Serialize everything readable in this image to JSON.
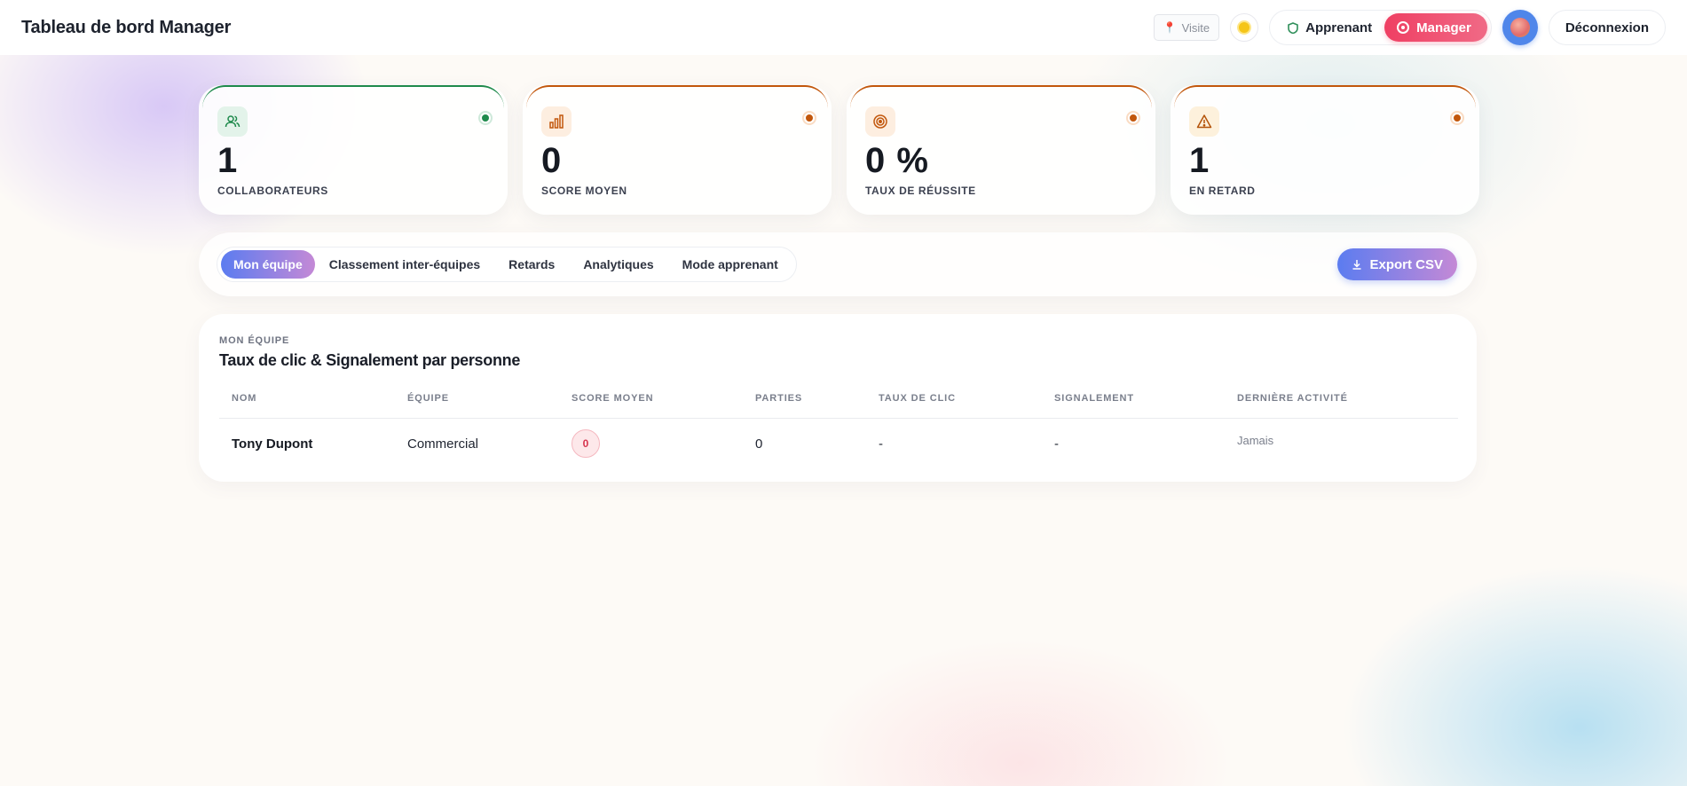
{
  "header": {
    "title": "Tableau de bord Manager",
    "visit_label": "Visite",
    "role_apprenant": "Apprenant",
    "role_manager": "Manager",
    "logout_label": "Déconnexion"
  },
  "stats": [
    {
      "value": "1",
      "label": "COLLABORATEURS",
      "icon": "users-icon",
      "accent": "#1f8a4c"
    },
    {
      "value": "0",
      "label": "SCORE MOYEN",
      "icon": "bar-chart-icon",
      "accent": "#c2570c"
    },
    {
      "value": "0 %",
      "label": "TAUX DE RÉUSSITE",
      "icon": "target-icon",
      "accent": "#c2570c"
    },
    {
      "value": "1",
      "label": "EN RETARD",
      "icon": "warning-icon",
      "accent": "#c2570c"
    }
  ],
  "tabs": [
    {
      "label": "Mon équipe",
      "active": true
    },
    {
      "label": "Classement inter-équipes",
      "active": false
    },
    {
      "label": "Retards",
      "active": false
    },
    {
      "label": "Analytiques",
      "active": false
    },
    {
      "label": "Mode apprenant",
      "active": false
    }
  ],
  "export_label": "Export CSV",
  "team": {
    "kicker": "MON ÉQUIPE",
    "title": "Taux de clic & Signalement par personne",
    "columns": [
      "NOM",
      "ÉQUIPE",
      "SCORE MOYEN",
      "PARTIES",
      "TAUX DE CLIC",
      "SIGNALEMENT",
      "DERNIÈRE ACTIVITÉ"
    ],
    "rows": [
      {
        "name": "Tony Dupont",
        "team": "Commercial",
        "score": "0",
        "games": "0",
        "click_rate": "-",
        "reporting": "-",
        "last_activity": "Jamais"
      }
    ]
  }
}
